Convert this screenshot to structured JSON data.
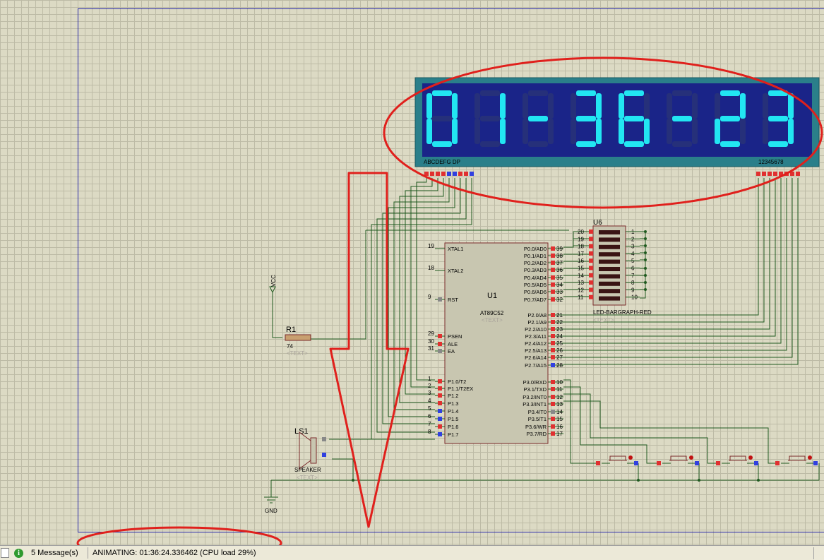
{
  "display": {
    "digits": [
      "0",
      "1",
      "-",
      "3",
      "6",
      "-",
      "2",
      "3"
    ],
    "segment_label": "ABCDEFG  DP",
    "digit_label": "12345678",
    "colors": {
      "lit": "#22e6f2",
      "unlit": "#26307a",
      "background": "#1a2488",
      "frame": "#2a7f8a"
    }
  },
  "u1": {
    "ref": "U1",
    "part": "AT89C52",
    "text": "<TEXT>",
    "left_pins": [
      {
        "num": "19",
        "name": "XTAL1"
      },
      {
        "num": "18",
        "name": "XTAL2"
      },
      {
        "num": "9",
        "name": "RST"
      },
      {
        "num": "29",
        "name": "PSEN"
      },
      {
        "num": "30",
        "name": "ALE"
      },
      {
        "num": "31",
        "name": "EA"
      },
      {
        "num": "1",
        "name": "P1.0/T2"
      },
      {
        "num": "2",
        "name": "P1.1/T2EX"
      },
      {
        "num": "3",
        "name": "P1.2"
      },
      {
        "num": "4",
        "name": "P1.3"
      },
      {
        "num": "5",
        "name": "P1.4"
      },
      {
        "num": "6",
        "name": "P1.5"
      },
      {
        "num": "7",
        "name": "P1.6"
      },
      {
        "num": "8",
        "name": "P1.7"
      }
    ],
    "right_pins": [
      {
        "num": "39",
        "name": "P0.0/AD0"
      },
      {
        "num": "38",
        "name": "P0.1/AD1"
      },
      {
        "num": "37",
        "name": "P0.2/AD2"
      },
      {
        "num": "36",
        "name": "P0.3/AD3"
      },
      {
        "num": "35",
        "name": "P0.4/AD4"
      },
      {
        "num": "34",
        "name": "P0.5/AD5"
      },
      {
        "num": "33",
        "name": "P0.6/AD6"
      },
      {
        "num": "32",
        "name": "P0.7/AD7"
      },
      {
        "num": "21",
        "name": "P2.0/A8"
      },
      {
        "num": "22",
        "name": "P2.1/A9"
      },
      {
        "num": "23",
        "name": "P2.2/A10"
      },
      {
        "num": "24",
        "name": "P2.3/A11"
      },
      {
        "num": "25",
        "name": "P2.4/A12"
      },
      {
        "num": "26",
        "name": "P2.5/A13"
      },
      {
        "num": "27",
        "name": "P2.6/A14"
      },
      {
        "num": "28",
        "name": "P2.7/A15"
      },
      {
        "num": "10",
        "name": "P3.0/RXD"
      },
      {
        "num": "11",
        "name": "P3.1/TXD"
      },
      {
        "num": "12",
        "name": "P3.2/INT0"
      },
      {
        "num": "13",
        "name": "P3.3/INT1"
      },
      {
        "num": "14",
        "name": "P3.4/T0"
      },
      {
        "num": "15",
        "name": "P3.5/T1"
      },
      {
        "num": "16",
        "name": "P3.6/WR"
      },
      {
        "num": "17",
        "name": "P3.7/RD"
      }
    ]
  },
  "u6": {
    "ref": "U6",
    "part": "LED-BARGRAPH-RED",
    "text": "<TEXT>",
    "left_nums": [
      "20",
      "19",
      "18",
      "17",
      "16",
      "15",
      "14",
      "13",
      "12",
      "11"
    ],
    "right_nums": [
      "1",
      "2",
      "3",
      "4",
      "5",
      "6",
      "7",
      "8",
      "9",
      "10"
    ]
  },
  "r1": {
    "ref": "R1",
    "value": "74",
    "text": "<TEXT>"
  },
  "vcc": {
    "label": "VCC"
  },
  "ls1": {
    "ref": "LS1",
    "part": "SPEAKER",
    "text": "<TEXT>"
  },
  "gnd": {
    "label": "GND"
  },
  "status_bar": {
    "messages": "5 Message(s)",
    "animation": "ANIMATING: 01:36:24.336462 (CPU load 29%)",
    "info_icon": "i"
  },
  "annotations": {
    "color": "#e0201c"
  }
}
